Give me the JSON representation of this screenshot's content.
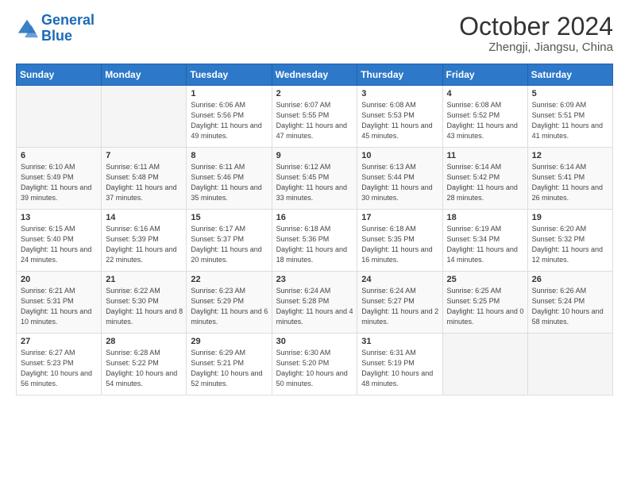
{
  "header": {
    "logo_line1": "General",
    "logo_line2": "Blue",
    "month": "October 2024",
    "location": "Zhengji, Jiangsu, China"
  },
  "weekdays": [
    "Sunday",
    "Monday",
    "Tuesday",
    "Wednesday",
    "Thursday",
    "Friday",
    "Saturday"
  ],
  "weeks": [
    [
      {
        "day": "",
        "empty": true
      },
      {
        "day": "",
        "empty": true
      },
      {
        "day": "1",
        "sunrise": "6:06 AM",
        "sunset": "5:56 PM",
        "daylight": "11 hours and 49 minutes."
      },
      {
        "day": "2",
        "sunrise": "6:07 AM",
        "sunset": "5:55 PM",
        "daylight": "11 hours and 47 minutes."
      },
      {
        "day": "3",
        "sunrise": "6:08 AM",
        "sunset": "5:53 PM",
        "daylight": "11 hours and 45 minutes."
      },
      {
        "day": "4",
        "sunrise": "6:08 AM",
        "sunset": "5:52 PM",
        "daylight": "11 hours and 43 minutes."
      },
      {
        "day": "5",
        "sunrise": "6:09 AM",
        "sunset": "5:51 PM",
        "daylight": "11 hours and 41 minutes."
      }
    ],
    [
      {
        "day": "6",
        "sunrise": "6:10 AM",
        "sunset": "5:49 PM",
        "daylight": "11 hours and 39 minutes."
      },
      {
        "day": "7",
        "sunrise": "6:11 AM",
        "sunset": "5:48 PM",
        "daylight": "11 hours and 37 minutes."
      },
      {
        "day": "8",
        "sunrise": "6:11 AM",
        "sunset": "5:46 PM",
        "daylight": "11 hours and 35 minutes."
      },
      {
        "day": "9",
        "sunrise": "6:12 AM",
        "sunset": "5:45 PM",
        "daylight": "11 hours and 33 minutes."
      },
      {
        "day": "10",
        "sunrise": "6:13 AM",
        "sunset": "5:44 PM",
        "daylight": "11 hours and 30 minutes."
      },
      {
        "day": "11",
        "sunrise": "6:14 AM",
        "sunset": "5:42 PM",
        "daylight": "11 hours and 28 minutes."
      },
      {
        "day": "12",
        "sunrise": "6:14 AM",
        "sunset": "5:41 PM",
        "daylight": "11 hours and 26 minutes."
      }
    ],
    [
      {
        "day": "13",
        "sunrise": "6:15 AM",
        "sunset": "5:40 PM",
        "daylight": "11 hours and 24 minutes."
      },
      {
        "day": "14",
        "sunrise": "6:16 AM",
        "sunset": "5:39 PM",
        "daylight": "11 hours and 22 minutes."
      },
      {
        "day": "15",
        "sunrise": "6:17 AM",
        "sunset": "5:37 PM",
        "daylight": "11 hours and 20 minutes."
      },
      {
        "day": "16",
        "sunrise": "6:18 AM",
        "sunset": "5:36 PM",
        "daylight": "11 hours and 18 minutes."
      },
      {
        "day": "17",
        "sunrise": "6:18 AM",
        "sunset": "5:35 PM",
        "daylight": "11 hours and 16 minutes."
      },
      {
        "day": "18",
        "sunrise": "6:19 AM",
        "sunset": "5:34 PM",
        "daylight": "11 hours and 14 minutes."
      },
      {
        "day": "19",
        "sunrise": "6:20 AM",
        "sunset": "5:32 PM",
        "daylight": "11 hours and 12 minutes."
      }
    ],
    [
      {
        "day": "20",
        "sunrise": "6:21 AM",
        "sunset": "5:31 PM",
        "daylight": "11 hours and 10 minutes."
      },
      {
        "day": "21",
        "sunrise": "6:22 AM",
        "sunset": "5:30 PM",
        "daylight": "11 hours and 8 minutes."
      },
      {
        "day": "22",
        "sunrise": "6:23 AM",
        "sunset": "5:29 PM",
        "daylight": "11 hours and 6 minutes."
      },
      {
        "day": "23",
        "sunrise": "6:24 AM",
        "sunset": "5:28 PM",
        "daylight": "11 hours and 4 minutes."
      },
      {
        "day": "24",
        "sunrise": "6:24 AM",
        "sunset": "5:27 PM",
        "daylight": "11 hours and 2 minutes."
      },
      {
        "day": "25",
        "sunrise": "6:25 AM",
        "sunset": "5:25 PM",
        "daylight": "11 hours and 0 minutes."
      },
      {
        "day": "26",
        "sunrise": "6:26 AM",
        "sunset": "5:24 PM",
        "daylight": "10 hours and 58 minutes."
      }
    ],
    [
      {
        "day": "27",
        "sunrise": "6:27 AM",
        "sunset": "5:23 PM",
        "daylight": "10 hours and 56 minutes."
      },
      {
        "day": "28",
        "sunrise": "6:28 AM",
        "sunset": "5:22 PM",
        "daylight": "10 hours and 54 minutes."
      },
      {
        "day": "29",
        "sunrise": "6:29 AM",
        "sunset": "5:21 PM",
        "daylight": "10 hours and 52 minutes."
      },
      {
        "day": "30",
        "sunrise": "6:30 AM",
        "sunset": "5:20 PM",
        "daylight": "10 hours and 50 minutes."
      },
      {
        "day": "31",
        "sunrise": "6:31 AM",
        "sunset": "5:19 PM",
        "daylight": "10 hours and 48 minutes."
      },
      {
        "day": "",
        "empty": true
      },
      {
        "day": "",
        "empty": true
      }
    ]
  ]
}
